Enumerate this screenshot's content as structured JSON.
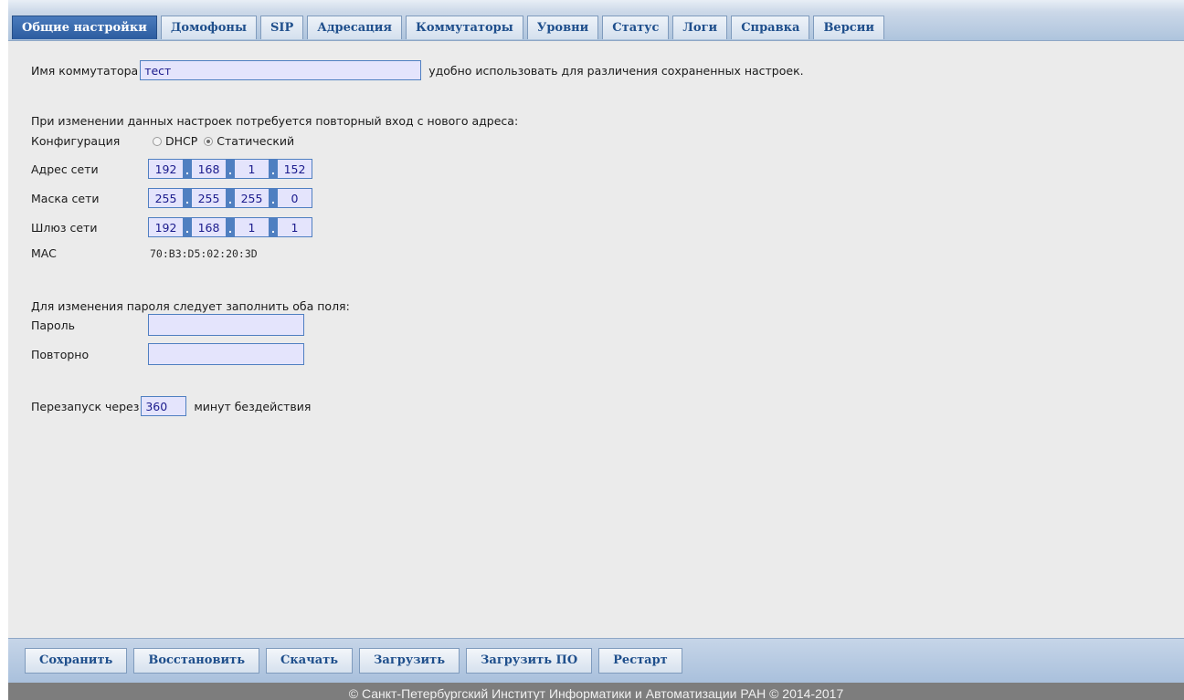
{
  "tabs": [
    {
      "label": "Общие настройки",
      "active": true
    },
    {
      "label": "Домофоны"
    },
    {
      "label": "SIP"
    },
    {
      "label": "Адресация"
    },
    {
      "label": "Коммутаторы"
    },
    {
      "label": "Уровни"
    },
    {
      "label": "Статус"
    },
    {
      "label": "Логи"
    },
    {
      "label": "Справка"
    },
    {
      "label": "Версии"
    }
  ],
  "general": {
    "switch_name_label": "Имя коммутатора",
    "switch_name_value": "тест",
    "switch_name_hint": "удобно использовать для различения сохраненных настроек."
  },
  "network": {
    "notice": "При изменении данных настроек потребуется повторный вход с нового адреса:",
    "config_label": "Конфигурация",
    "config_options": [
      "DHCP",
      "Статический"
    ],
    "config_selected": "Статический",
    "address_label": "Адрес сети",
    "address": [
      "192",
      "168",
      "1",
      "152"
    ],
    "mask_label": "Маска сети",
    "mask": [
      "255",
      "255",
      "255",
      "0"
    ],
    "gateway_label": "Шлюз сети",
    "gateway": [
      "192",
      "168",
      "1",
      "1"
    ],
    "mac_label": "MAC",
    "mac_value": "70:B3:D5:02:20:3D"
  },
  "password": {
    "notice": "Для изменения пароля следует заполнить оба поля:",
    "password_label": "Пароль",
    "password_value": "",
    "repeat_label": "Повторно",
    "repeat_value": ""
  },
  "restart": {
    "prefix": "Перезапуск через",
    "value": "360",
    "suffix": "минут бездействия"
  },
  "buttons": {
    "save": "Сохранить",
    "restore": "Восстановить",
    "download": "Скачать",
    "upload": "Загрузить",
    "upload_fw": "Загрузить ПО",
    "restart": "Рестарт"
  },
  "footer": {
    "copyright": "© Санкт-Петербургский Институт Информатики и Автоматизации РАН © 2014-2017"
  }
}
